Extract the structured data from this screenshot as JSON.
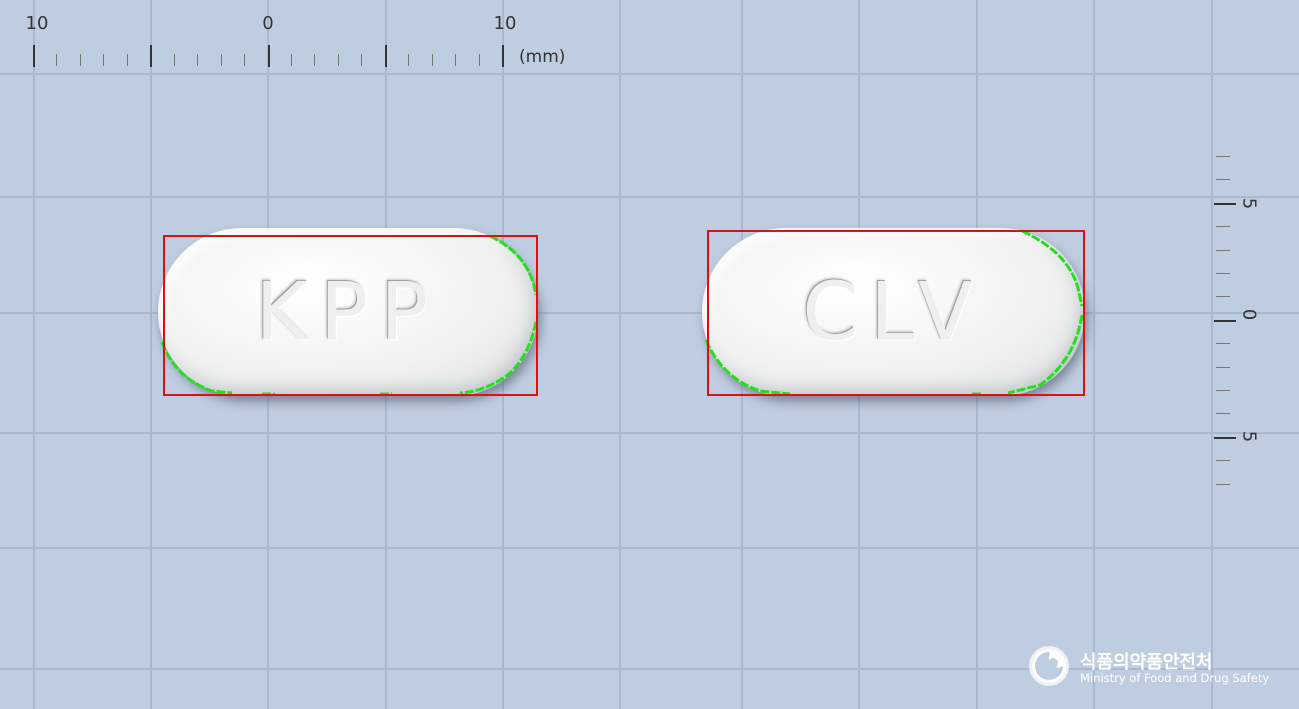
{
  "top_ruler": {
    "labels": [
      "10",
      "0",
      "10"
    ],
    "unit": "(mm)"
  },
  "right_ruler": {
    "labels": [
      "5",
      "0",
      "5"
    ]
  },
  "pills": [
    {
      "imprint": "KPP",
      "color": "white",
      "shape": "oblong"
    },
    {
      "imprint": "CLV",
      "color": "white",
      "shape": "oblong"
    }
  ],
  "overlay_colors": {
    "bounding_box": "#e01010",
    "contour": "#22e01c",
    "background": "#bfcde0",
    "grid": "#a9b8cc"
  },
  "logo": {
    "icon": "mfds-emblem-icon",
    "name_kr": "식품의약품안전처",
    "name_en": "Ministry of Food and Drug Safety"
  }
}
